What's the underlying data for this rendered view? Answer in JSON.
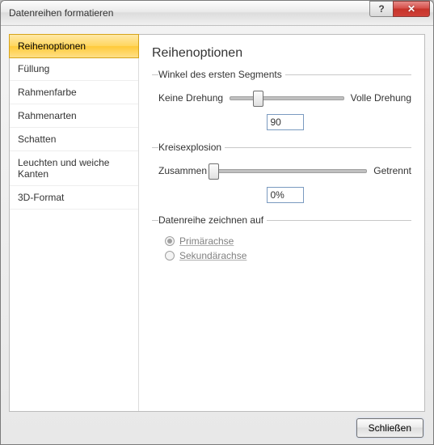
{
  "window": {
    "title": "Datenreihen formatieren"
  },
  "sidebar": {
    "items": [
      {
        "label": "Reihenoptionen",
        "selected": true
      },
      {
        "label": "Füllung"
      },
      {
        "label": "Rahmenfarbe"
      },
      {
        "label": "Rahmenarten"
      },
      {
        "label": "Schatten"
      },
      {
        "label": "Leuchten und weiche Kanten"
      },
      {
        "label": "3D-Format"
      }
    ]
  },
  "content": {
    "heading": "Reihenoptionen",
    "angle_group": {
      "legend": "Winkel des ersten Segments",
      "left_label": "Keine Drehung",
      "right_label": "Volle Drehung",
      "value": "90",
      "slider_percent": 25
    },
    "explosion_group": {
      "legend": "Kreisexplosion",
      "left_label": "Zusammen",
      "right_label": "Getrennt",
      "value": "0%",
      "slider_percent": 0
    },
    "axis_group": {
      "legend": "Datenreihe zeichnen auf",
      "options": [
        {
          "label": "Primärachse",
          "checked": true
        },
        {
          "label": "Sekundärachse",
          "checked": false
        }
      ]
    }
  },
  "footer": {
    "close_label": "Schließen"
  }
}
